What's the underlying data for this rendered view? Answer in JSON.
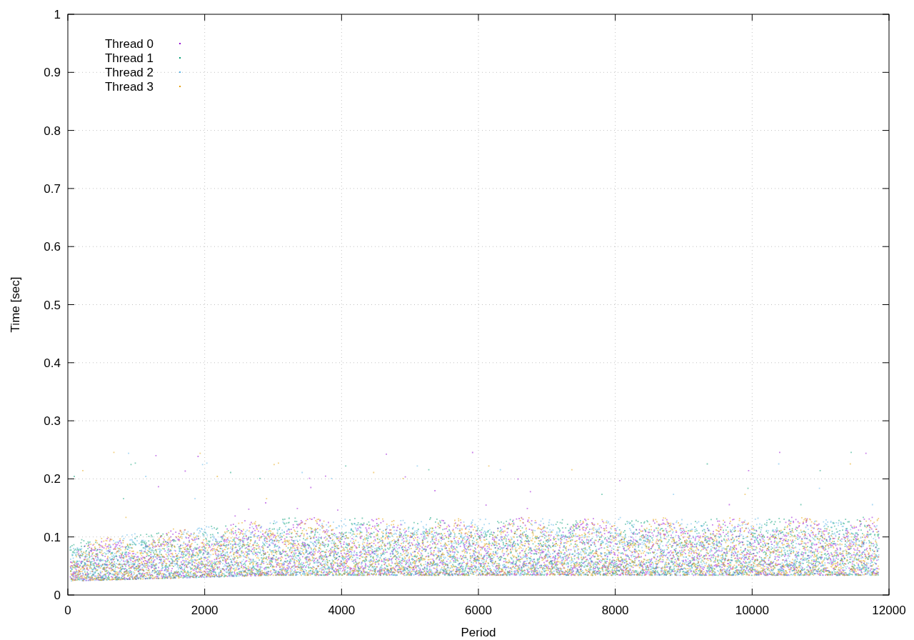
{
  "plot": {
    "x_axis_title": "Period",
    "y_axis_title": "Time [sec]",
    "x_tick_labels": [
      "0",
      "2000",
      "4000",
      "6000",
      "8000",
      "10000",
      "12000"
    ],
    "y_tick_labels": [
      "1",
      "0.9",
      "0.8",
      "0.7",
      "0.6",
      "0.5",
      "0.4",
      "0.3",
      "0.2",
      "0.1",
      "0"
    ],
    "legend": [
      {
        "name": "Thread 0",
        "color": "#9400d3"
      },
      {
        "name": "Thread 1",
        "color": "#009e73"
      },
      {
        "name": "Thread 2",
        "color": "#56b4e9"
      },
      {
        "name": "Thread 3",
        "color": "#e69f00"
      }
    ]
  }
}
